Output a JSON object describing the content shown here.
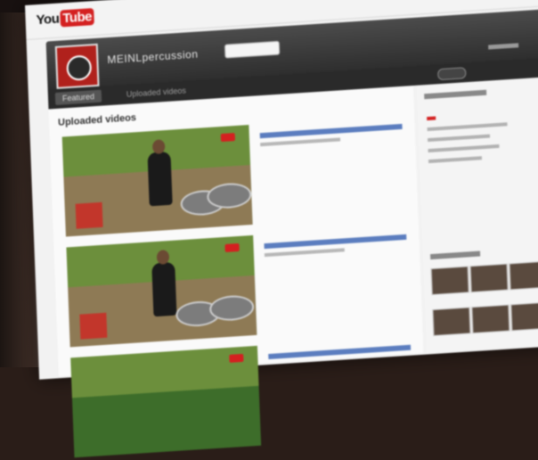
{
  "header": {
    "logo_you": "You",
    "logo_tube": "Tube"
  },
  "channel": {
    "name": "MEINLpercussion"
  },
  "tabs": [
    {
      "label": "Featured"
    },
    {
      "label": "Uploaded videos"
    }
  ],
  "main": {
    "section_title": "Uploaded videos"
  },
  "colors": {
    "brand_red": "#d42020",
    "header_dark": "#2e2e2e",
    "link_blue": "#5b7dbf"
  }
}
